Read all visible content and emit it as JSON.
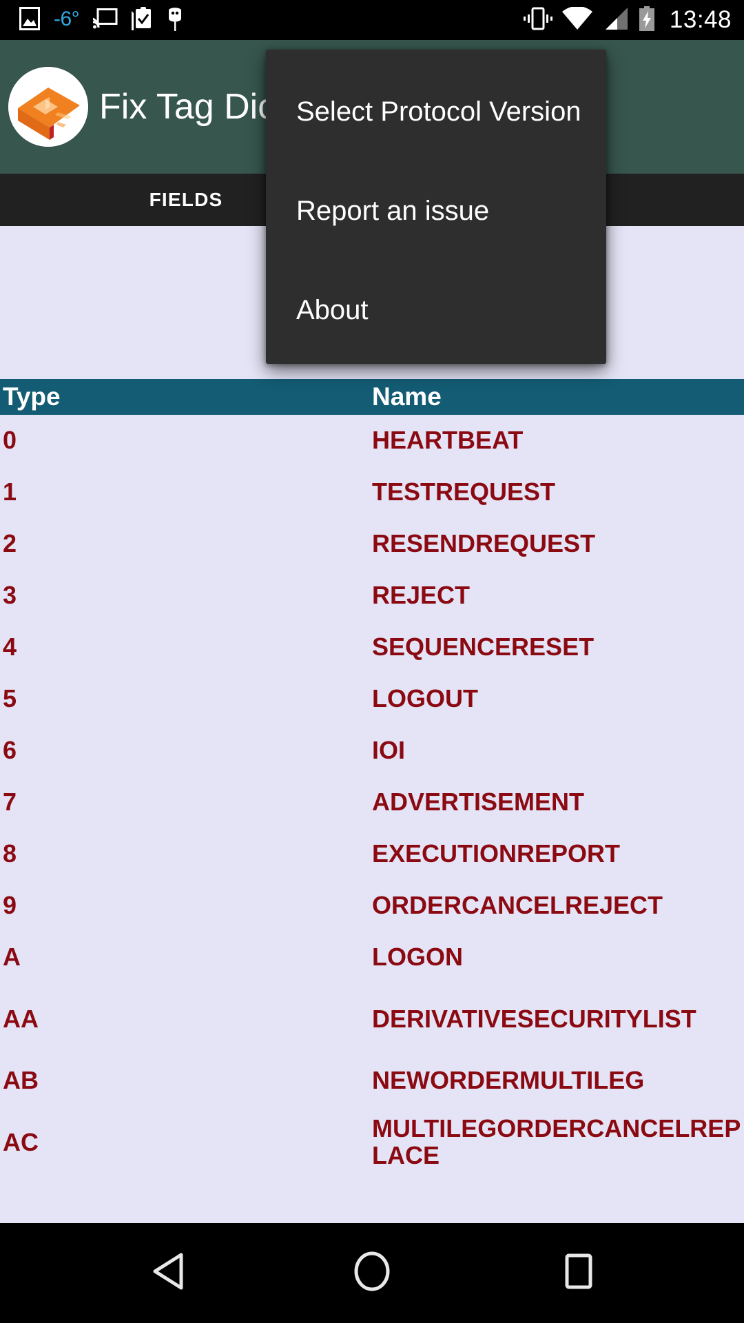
{
  "status_bar": {
    "icons_left": [
      "image-icon",
      "temperature-indicator",
      "cast-icon",
      "clipboard-check-icon",
      "android-debug-icon"
    ],
    "temperature": "-6°",
    "icons_right": [
      "vibrate-icon",
      "wifi-icon",
      "cellular-signal-icon",
      "battery-charging-icon"
    ],
    "clock": "13:48"
  },
  "app_bar": {
    "title": "Fix Tag Dicti",
    "logo_name": "app-logo-dictionary",
    "background_color": "#37564E"
  },
  "tabs": {
    "items": [
      {
        "label": "FIELDS",
        "selected": true
      }
    ],
    "background_color": "#212121"
  },
  "overflow_menu": {
    "visible": true,
    "background_color": "#2E2E2E",
    "items": [
      {
        "label": "Select Protocol Version"
      },
      {
        "label": "Report an issue"
      },
      {
        "label": "About"
      }
    ]
  },
  "table": {
    "header_color": "#135C74",
    "row_text_color": "#8B0A12",
    "background_color": "#E4E4F6",
    "columns": [
      "Type",
      "Name"
    ],
    "rows": [
      {
        "type": "0",
        "name": "HEARTBEAT"
      },
      {
        "type": "1",
        "name": "TESTREQUEST"
      },
      {
        "type": "2",
        "name": "RESENDREQUEST"
      },
      {
        "type": "3",
        "name": "REJECT"
      },
      {
        "type": "4",
        "name": "SEQUENCERESET"
      },
      {
        "type": "5",
        "name": "LOGOUT"
      },
      {
        "type": "6",
        "name": "IOI"
      },
      {
        "type": "7",
        "name": "ADVERTISEMENT"
      },
      {
        "type": "8",
        "name": "EXECUTIONREPORT"
      },
      {
        "type": "9",
        "name": "ORDERCANCELREJECT"
      },
      {
        "type": "A",
        "name": "LOGON"
      },
      {
        "type": "AA",
        "name": "DERIVATIVESECURITYLIST"
      },
      {
        "type": "AB",
        "name": "NEWORDERMULTILEG"
      },
      {
        "type": "AC",
        "name": "MULTILEGORDERCANCELREPLACE"
      }
    ]
  },
  "nav_bar": {
    "buttons": [
      {
        "name": "back-button",
        "icon": "triangle-left-icon"
      },
      {
        "name": "home-button",
        "icon": "circle-icon"
      },
      {
        "name": "recents-button",
        "icon": "square-icon"
      }
    ]
  }
}
